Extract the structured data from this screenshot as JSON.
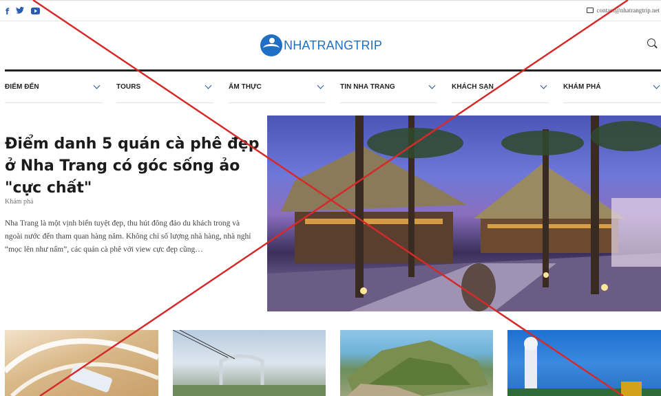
{
  "topbar": {
    "social": [
      {
        "icon": "facebook-icon",
        "glyph": "f"
      },
      {
        "icon": "twitter-icon",
        "glyph": "🐦"
      },
      {
        "icon": "youtube-icon",
        "glyph": "▶"
      }
    ],
    "contact_email": "contact@nhatrangtrip.net"
  },
  "header": {
    "logo_text": "NHATRANGTRIP"
  },
  "nav": {
    "items": [
      {
        "label": "ĐIỂM ĐẾN"
      },
      {
        "label": "TOURS"
      },
      {
        "label": "ẨM THỰC"
      },
      {
        "label": "TIN NHA TRANG"
      },
      {
        "label": "KHÁCH SẠN"
      },
      {
        "label": "KHÁM PHÁ"
      }
    ]
  },
  "featured": {
    "title": "Điểm danh 5 quán cà phê đẹp ở Nha Trang có góc sống ảo \"cực chất\"",
    "category": "Khám phá",
    "excerpt": "Nha Trang là một vịnh biển tuyệt đẹp, thu hút đông đảo du khách trong và ngoài nước đến tham quan hàng năm. Không chỉ số lượng nhà hàng, nhà nghỉ “mọc lên như nấm”, các quán cà phê với view cực đẹp cũng…"
  },
  "colors": {
    "accent": "#1f6fc4",
    "overlay_cross": "#d42a2a"
  }
}
